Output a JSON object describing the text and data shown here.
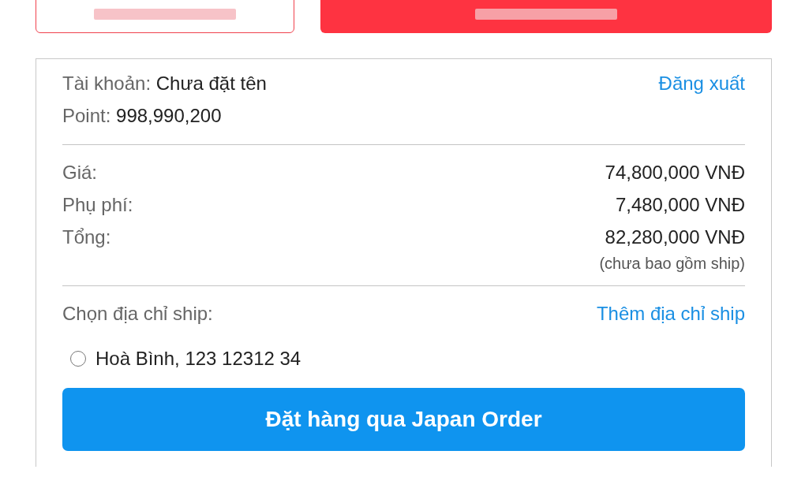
{
  "top_buttons": [
    {
      "kind": "outline"
    },
    {
      "kind": "filled"
    }
  ],
  "account": {
    "label": "Tài khoản:",
    "value": "Chưa đặt tên",
    "logout_link": "Đăng xuất"
  },
  "point": {
    "label": "Point:",
    "value": "998,990,200"
  },
  "prices": [
    {
      "label": "Giá:",
      "value": "74,800,000 VNĐ"
    },
    {
      "label": "Phụ phí:",
      "value": "7,480,000 VNĐ"
    },
    {
      "label": "Tổng:",
      "value": "82,280,000 VNĐ"
    }
  ],
  "price_note": "(chưa bao gồm ship)",
  "shipping": {
    "label": "Chọn địa chỉ ship:",
    "add_link": "Thêm địa chỉ ship",
    "addresses": [
      {
        "text": "Hoà Bình, 123 12312 34",
        "selected": false
      }
    ]
  },
  "submit_button": "Đặt hàng qua Japan Order"
}
